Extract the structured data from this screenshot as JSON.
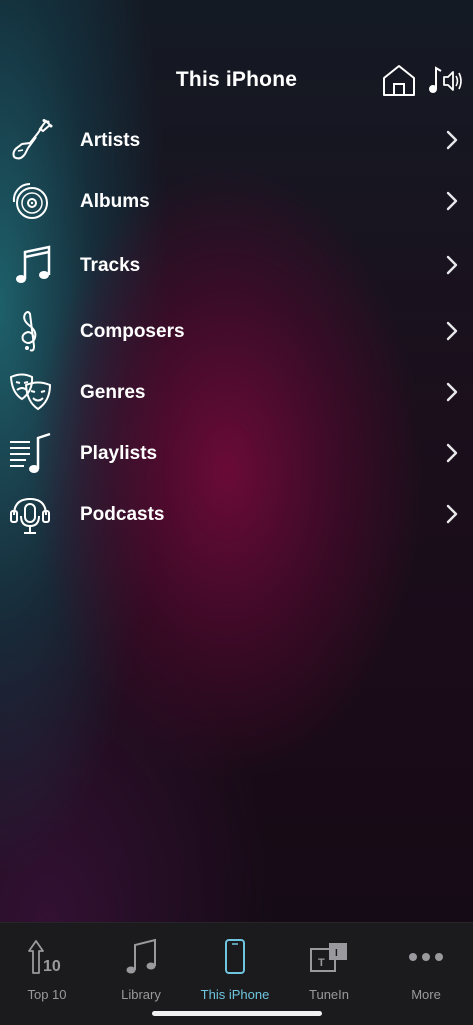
{
  "header": {
    "title": "This iPhone",
    "home_icon": "house-icon",
    "speaker_icon": "music-speaker-icon"
  },
  "menu": {
    "items": [
      {
        "label": "Artists",
        "icon": "guitar-icon"
      },
      {
        "label": "Albums",
        "icon": "vinyl-record-icon"
      },
      {
        "label": "Tracks",
        "icon": "music-note-icon"
      },
      {
        "label": "Composers",
        "icon": "treble-clef-icon"
      },
      {
        "label": "Genres",
        "icon": "theater-masks-icon"
      },
      {
        "label": "Playlists",
        "icon": "playlist-icon"
      },
      {
        "label": "Podcasts",
        "icon": "podcast-microphone-icon"
      }
    ]
  },
  "tabbar": {
    "tabs": [
      {
        "label": "Top 10",
        "icon": "top10-arrow-icon",
        "active": false
      },
      {
        "label": "Library",
        "icon": "music-note-icon",
        "active": false
      },
      {
        "label": "This iPhone",
        "icon": "iphone-icon",
        "active": true
      },
      {
        "label": "TuneIn",
        "icon": "tunein-icon",
        "active": false
      },
      {
        "label": "More",
        "icon": "ellipsis-icon",
        "active": false
      }
    ]
  },
  "colors": {
    "active_tab": "#6fc4de",
    "inactive_tab": "#9a9a9e",
    "tabbar_bg": "#1b1b1d"
  }
}
